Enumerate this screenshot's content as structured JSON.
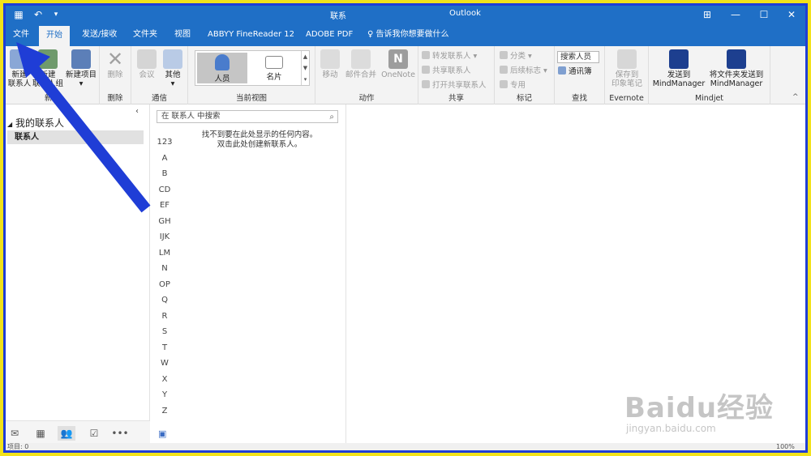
{
  "titlebar": {
    "folder": "联系",
    "app": "Outlook",
    "icons": [
      "calendar-icon",
      "undo-icon",
      "customize-icon"
    ],
    "controls": [
      "ribbon-display-icon",
      "minimize-icon",
      "maximize-icon",
      "close-icon"
    ]
  },
  "tabs": [
    {
      "label": "文件"
    },
    {
      "label": "开始",
      "active": true
    },
    {
      "label": "发送/接收"
    },
    {
      "label": "文件夹"
    },
    {
      "label": "视图"
    },
    {
      "label": "ABBYY FineReader 12"
    },
    {
      "label": "ADOBE PDF"
    }
  ],
  "tell_me": "告诉我你想要做什么",
  "ribbon": {
    "new": {
      "label": "新建",
      "new_contact_line1": "新建",
      "new_contact_line2": "联系人",
      "new_group_line2": "联系人组",
      "new_item": "新建项目"
    },
    "delete": {
      "label": "删除",
      "button": "删除"
    },
    "communicate": {
      "label": "通信",
      "meeting": "会议",
      "more": "其他"
    },
    "current_view": {
      "label": "当前视图",
      "people": "人员",
      "card": "名片"
    },
    "actions": {
      "label": "动作",
      "move": "移动",
      "mail_merge": "邮件合并",
      "onenote": "OneNote"
    },
    "share": {
      "label": "共享",
      "forward_contact": "转发联系人",
      "share_contacts": "共享联系人",
      "open_shared": "打开共享联系人"
    },
    "tags": {
      "label": "标记",
      "categorize": "分类",
      "follow_up": "后续标志",
      "private": "专用"
    },
    "find": {
      "label": "查找",
      "search_people": "搜索人员",
      "address_book": "通讯簿"
    },
    "evernote": {
      "label": "Evernote",
      "save_line1": "保存到",
      "save_line2": "印象笔记"
    },
    "mindjet": {
      "label": "Mindjet",
      "send_line1": "发送到",
      "send_line2": "MindManager",
      "send_folder_line1": "将文件夹发送到",
      "send_folder_line2": "MindManager"
    }
  },
  "navpane": {
    "root": "我的联系人",
    "selected": "联系人"
  },
  "list": {
    "search_placeholder": "在 联系人 中搜索",
    "empty_line1": "找不到要在此处显示的任何内容。",
    "empty_line2": "双击此处创建新联系人。",
    "index": [
      "123",
      "A",
      "B",
      "CD",
      "EF",
      "GH",
      "IJK",
      "LM",
      "N",
      "OP",
      "Q",
      "R",
      "S",
      "T",
      "W",
      "X",
      "Y",
      "Z"
    ]
  },
  "bottomnav": [
    "mail-icon",
    "calendar-icon",
    "people-icon",
    "tasks-icon",
    "more-icon"
  ],
  "status": {
    "items": "项目: 0",
    "zoom": "100%"
  },
  "watermark": {
    "main": "Baidu经验",
    "sub": "jingyan.baidu.com"
  },
  "colors": {
    "accent": "#1f6fc6",
    "annotation_arrow": "#1f3dd6",
    "frame": "#f2e21a"
  }
}
